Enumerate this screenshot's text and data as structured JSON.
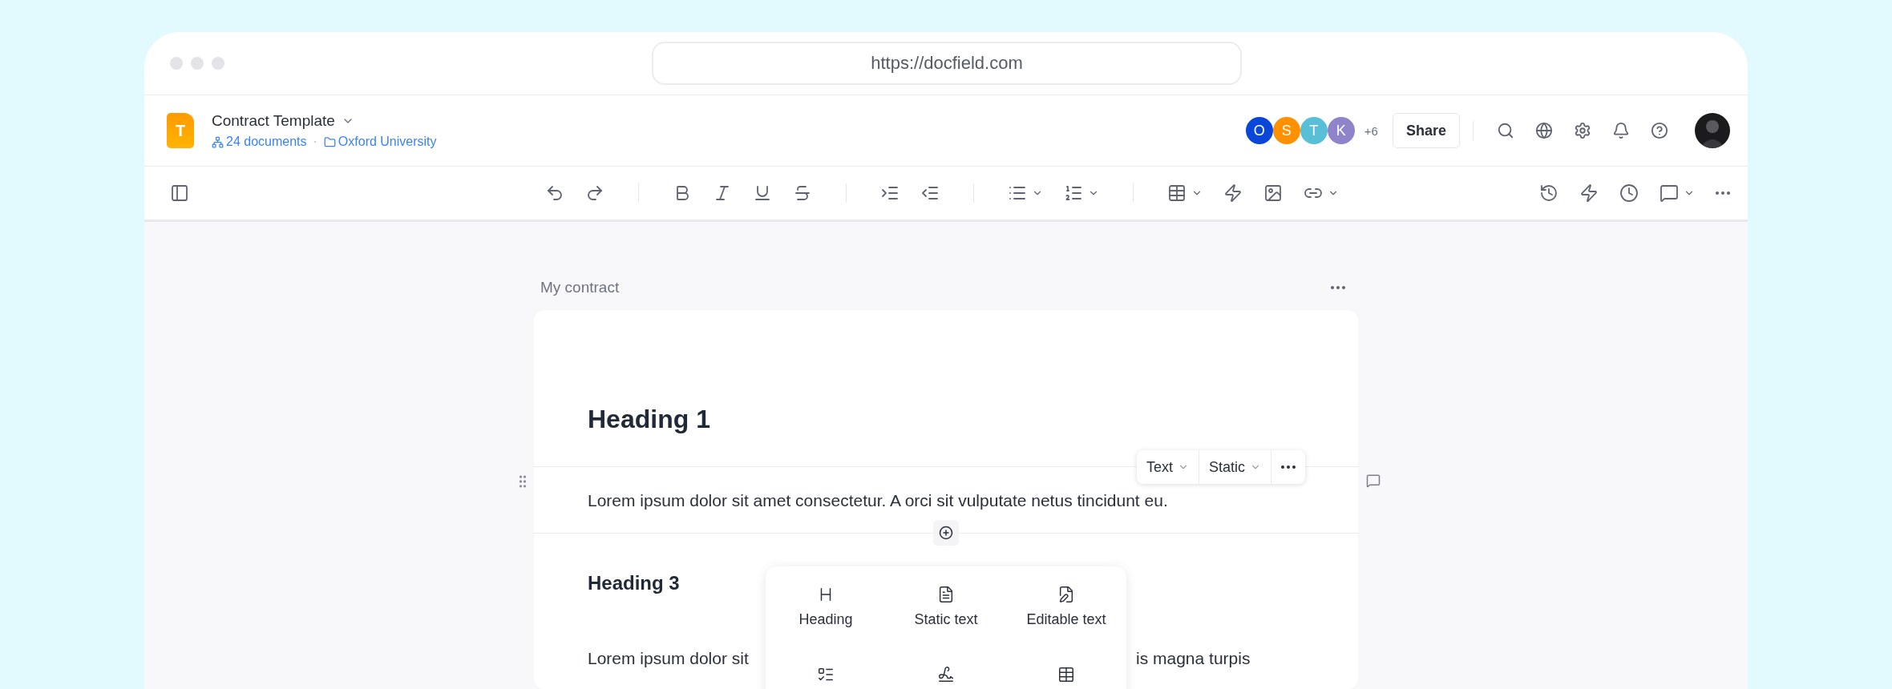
{
  "browser": {
    "url": "https://docfield.com"
  },
  "header": {
    "file_initial": "T",
    "title": "Contract Template",
    "documents": "24 documents",
    "separator": "·",
    "folder": "Oxford University",
    "collaborators": [
      {
        "initial": "O",
        "color": "#0a46d8"
      },
      {
        "initial": "S",
        "color": "#ff9100"
      },
      {
        "initial": "T",
        "color": "#58bfd6"
      },
      {
        "initial": "K",
        "color": "#8f84c9"
      }
    ],
    "more_collaborators": "+6",
    "share": "Share"
  },
  "document": {
    "title": "My contract",
    "blocks": [
      {
        "kind": "heading1",
        "text": "Heading 1"
      },
      {
        "kind": "paragraph",
        "text": "Lorem ipsum dolor sit amet consectetur. A orci sit vulputate netus tincidunt eu."
      },
      {
        "kind": "heading3",
        "text": "Heading 3"
      },
      {
        "kind": "covered_paragraph",
        "left": "Lorem ipsum dolor sit",
        "right": "is magna turpis"
      }
    ],
    "block_toolbar": {
      "type": "Text",
      "mode": "Static"
    }
  },
  "insert_menu": [
    {
      "kind": "heading",
      "label": "Heading"
    },
    {
      "kind": "static",
      "label": "Static text"
    },
    {
      "kind": "editable",
      "label": "Editable text"
    },
    {
      "kind": "checklist"
    },
    {
      "kind": "signature"
    },
    {
      "kind": "table"
    }
  ]
}
